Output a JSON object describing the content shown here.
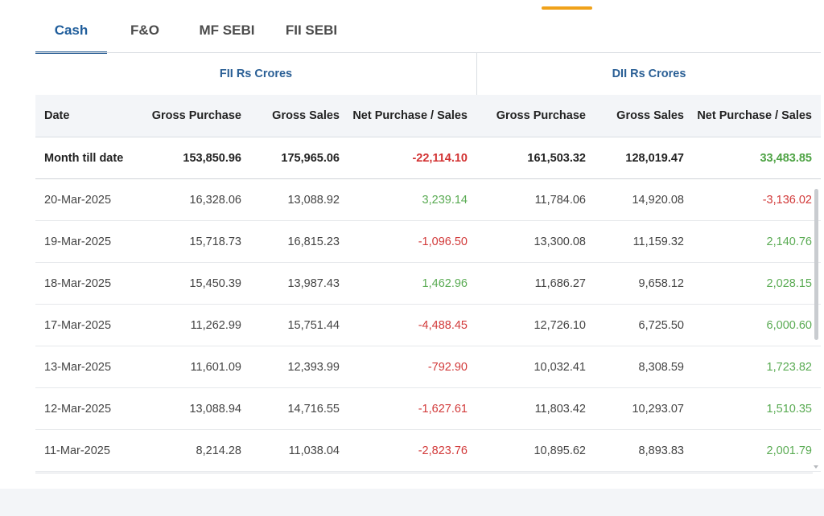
{
  "tabs": [
    {
      "label": "Cash",
      "active": true
    },
    {
      "label": "F&O",
      "active": false
    },
    {
      "label": "MF SEBI",
      "active": false
    },
    {
      "label": "FII SEBI",
      "active": false
    }
  ],
  "groups": {
    "fii": "FII Rs Crores",
    "dii": "DII Rs Crores"
  },
  "columns": [
    "Date",
    "Gross Purchase",
    "Gross Sales",
    "Net Purchase / Sales",
    "Gross Purchase",
    "Gross Sales",
    "Net Purchase / Sales"
  ],
  "month_till_date": {
    "label": "Month till date",
    "values": [
      "153,850.96",
      "175,965.06",
      "-22,114.10",
      "161,503.32",
      "128,019.47",
      "33,483.85"
    ]
  },
  "rows": [
    {
      "date": "20-Mar-2025",
      "values": [
        "16,328.06",
        "13,088.92",
        "3,239.14",
        "11,784.06",
        "14,920.08",
        "-3,136.02"
      ]
    },
    {
      "date": "19-Mar-2025",
      "values": [
        "15,718.73",
        "16,815.23",
        "-1,096.50",
        "13,300.08",
        "11,159.32",
        "2,140.76"
      ]
    },
    {
      "date": "18-Mar-2025",
      "values": [
        "15,450.39",
        "13,987.43",
        "1,462.96",
        "11,686.27",
        "9,658.12",
        "2,028.15"
      ]
    },
    {
      "date": "17-Mar-2025",
      "values": [
        "11,262.99",
        "15,751.44",
        "-4,488.45",
        "12,726.10",
        "6,725.50",
        "6,000.60"
      ]
    },
    {
      "date": "13-Mar-2025",
      "values": [
        "11,601.09",
        "12,393.99",
        "-792.90",
        "10,032.41",
        "8,308.59",
        "1,723.82"
      ]
    },
    {
      "date": "12-Mar-2025",
      "values": [
        "13,088.94",
        "14,716.55",
        "-1,627.61",
        "11,803.42",
        "10,293.07",
        "1,510.35"
      ]
    },
    {
      "date": "11-Mar-2025",
      "values": [
        "8,214.28",
        "11,038.04",
        "-2,823.76",
        "10,895.62",
        "8,893.83",
        "2,001.79"
      ]
    }
  ],
  "colors": {
    "accent": "#1f5d9b",
    "positive": "#5aab53",
    "negative": "#d23a3a",
    "top_indicator": "#f0a21a"
  }
}
